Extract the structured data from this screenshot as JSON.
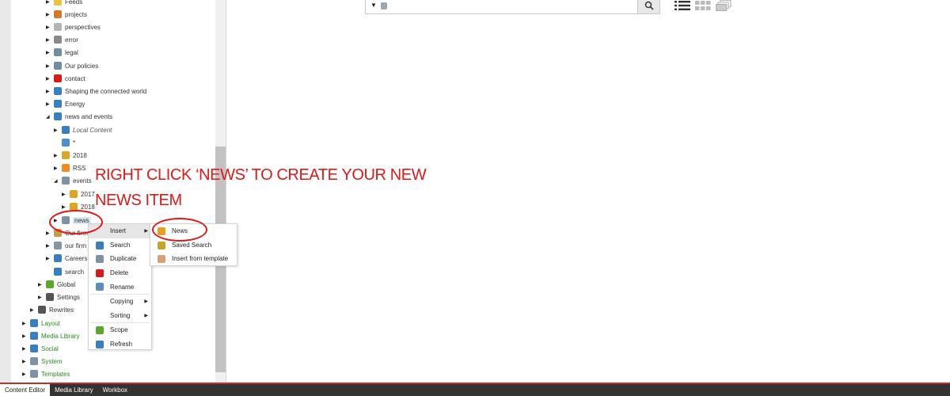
{
  "tree": {
    "items": [
      {
        "label": "Feeds",
        "arrow": "▶",
        "icon": "folder-icon",
        "color": "#e8c441",
        "style": ""
      },
      {
        "label": "projects",
        "arrow": "▶",
        "icon": "people-icon",
        "color": "#d9762a",
        "style": ""
      },
      {
        "label": "perspectives",
        "arrow": "▶",
        "icon": "cloud-icon",
        "color": "#b5b5b5",
        "style": ""
      },
      {
        "label": "error",
        "arrow": "▶",
        "icon": "home-icon",
        "color": "#8a8a8a",
        "style": ""
      },
      {
        "label": "legal",
        "arrow": "▶",
        "icon": "ribbon-icon",
        "color": "#6f8da3",
        "style": ""
      },
      {
        "label": "Our policies",
        "arrow": "▶",
        "icon": "ribbon-icon",
        "color": "#6f8da3",
        "style": ""
      },
      {
        "label": "contact",
        "arrow": "▶",
        "icon": "pin-icon",
        "color": "#d41c1c",
        "style": ""
      },
      {
        "label": "Shaping the connected world",
        "arrow": "▶",
        "icon": "globe-icon",
        "color": "#3a7ec2",
        "style": ""
      },
      {
        "label": "Energy",
        "arrow": "▶",
        "icon": "globe-icon",
        "color": "#3a7ec2",
        "style": ""
      },
      {
        "label": "news and events",
        "arrow": "◢",
        "icon": "globe-people-icon",
        "color": "#3a7ec2",
        "style": ""
      },
      {
        "label": "Local Content",
        "arrow": "▶",
        "icon": "globe-icon",
        "color": "#3a7ec2",
        "style": "italic"
      },
      {
        "label": "*",
        "arrow": "",
        "icon": "snowflake-icon",
        "color": "#4a90d2",
        "style": ""
      },
      {
        "label": "2018",
        "arrow": "▶",
        "icon": "calendar-icon",
        "color": "#d9a62a",
        "style": ""
      },
      {
        "label": "RSS",
        "arrow": "▶",
        "icon": "rss-icon",
        "color": "#f08a24",
        "style": ""
      },
      {
        "label": "events",
        "arrow": "◢",
        "icon": "database-icon",
        "color": "#7f92a3",
        "style": ""
      },
      {
        "label": "2017",
        "arrow": "▶",
        "icon": "calendar-icon",
        "color": "#d9a62a",
        "style": ""
      },
      {
        "label": "2018",
        "arrow": "▶",
        "icon": "calendar-icon",
        "color": "#d9a62a",
        "style": ""
      },
      {
        "label": "news",
        "arrow": "▶",
        "icon": "database-icon",
        "color": "#7f92a3",
        "style": "sel"
      },
      {
        "label": "Our firm",
        "arrow": "▶",
        "icon": "building-icon",
        "color": "#c89b4a",
        "style": ""
      },
      {
        "label": "our firm",
        "arrow": "▶",
        "icon": "document-icon",
        "color": "#8896a3",
        "style": ""
      },
      {
        "label": "Careers",
        "arrow": "▶",
        "icon": "target-icon",
        "color": "#3a7ec2",
        "style": ""
      },
      {
        "label": "search",
        "arrow": "",
        "icon": "search-icon",
        "color": "#3a7ec2",
        "style": ""
      },
      {
        "label": "Global",
        "arrow": "▶",
        "icon": "leaf-icon",
        "color": "#5aa82a",
        "style": ""
      },
      {
        "label": "Settings",
        "arrow": "▶",
        "icon": "gear-icon",
        "color": "#555555",
        "style": ""
      },
      {
        "label": "Rewrites",
        "arrow": "▶",
        "icon": "gear-icon",
        "color": "#555555",
        "style": ""
      },
      {
        "label": "Layout",
        "arrow": "▶",
        "icon": "layout-icon",
        "color": "#3a7ec2",
        "style": "green"
      },
      {
        "label": "Media Library",
        "arrow": "▶",
        "icon": "image-icon",
        "color": "#3a7ec2",
        "style": "green"
      },
      {
        "label": "Social",
        "arrow": "▶",
        "icon": "globe-icon",
        "color": "#3a7ec2",
        "style": "green"
      },
      {
        "label": "System",
        "arrow": "▶",
        "icon": "system-icon",
        "color": "#7f92a3",
        "style": "green"
      },
      {
        "label": "Templates",
        "arrow": "▶",
        "icon": "template-icon",
        "color": "#7f92a3",
        "style": "green"
      }
    ]
  },
  "search": {
    "caret": "▼",
    "icon": "database-icon",
    "button_icon": "search-icon"
  },
  "view_buttons": [
    {
      "icon": "details-view-icon"
    },
    {
      "icon": "grid-view-icon"
    },
    {
      "icon": "stack-view-icon"
    }
  ],
  "annotation": {
    "line1": "RIGHT CLICK ‘NEWS’ TO CREATE YOUR NEW",
    "line2": "NEWS ITEM",
    "color": "#e01818"
  },
  "context_menu": {
    "items": [
      {
        "label": "Insert",
        "icon": "",
        "submenu": true,
        "active": true
      },
      {
        "label": "Search",
        "icon": "search-icon",
        "submenu": false,
        "active": false
      },
      {
        "label": "Duplicate",
        "icon": "duplicate-icon",
        "submenu": false,
        "active": false
      },
      {
        "label": "Delete",
        "icon": "delete-icon",
        "submenu": false,
        "active": false
      },
      {
        "label": "Rename",
        "icon": "rename-icon",
        "submenu": false,
        "active": false
      },
      {
        "label": "Copying",
        "icon": "",
        "submenu": true,
        "active": false
      },
      {
        "label": "Sorting",
        "icon": "",
        "submenu": true,
        "active": false
      },
      {
        "label": "Scope",
        "icon": "scope-icon",
        "submenu": false,
        "active": false
      },
      {
        "label": "Refresh",
        "icon": "refresh-icon",
        "submenu": false,
        "active": false
      }
    ],
    "submenu_arrow": "▶"
  },
  "insert_menu": {
    "items": [
      {
        "label": "News",
        "icon": "news-icon"
      },
      {
        "label": "Saved Search",
        "icon": "saved-search-icon"
      },
      {
        "label": "Insert from template",
        "icon": "template-icon"
      }
    ]
  },
  "bottom_tabs": [
    {
      "label": "Content Editor",
      "active": true
    },
    {
      "label": "Media Library",
      "active": false
    },
    {
      "label": "Workbox",
      "active": false
    }
  ],
  "colors": {
    "accent": "#c32d2d",
    "annotation": "#e01818",
    "bottom_bar": "#333333"
  }
}
